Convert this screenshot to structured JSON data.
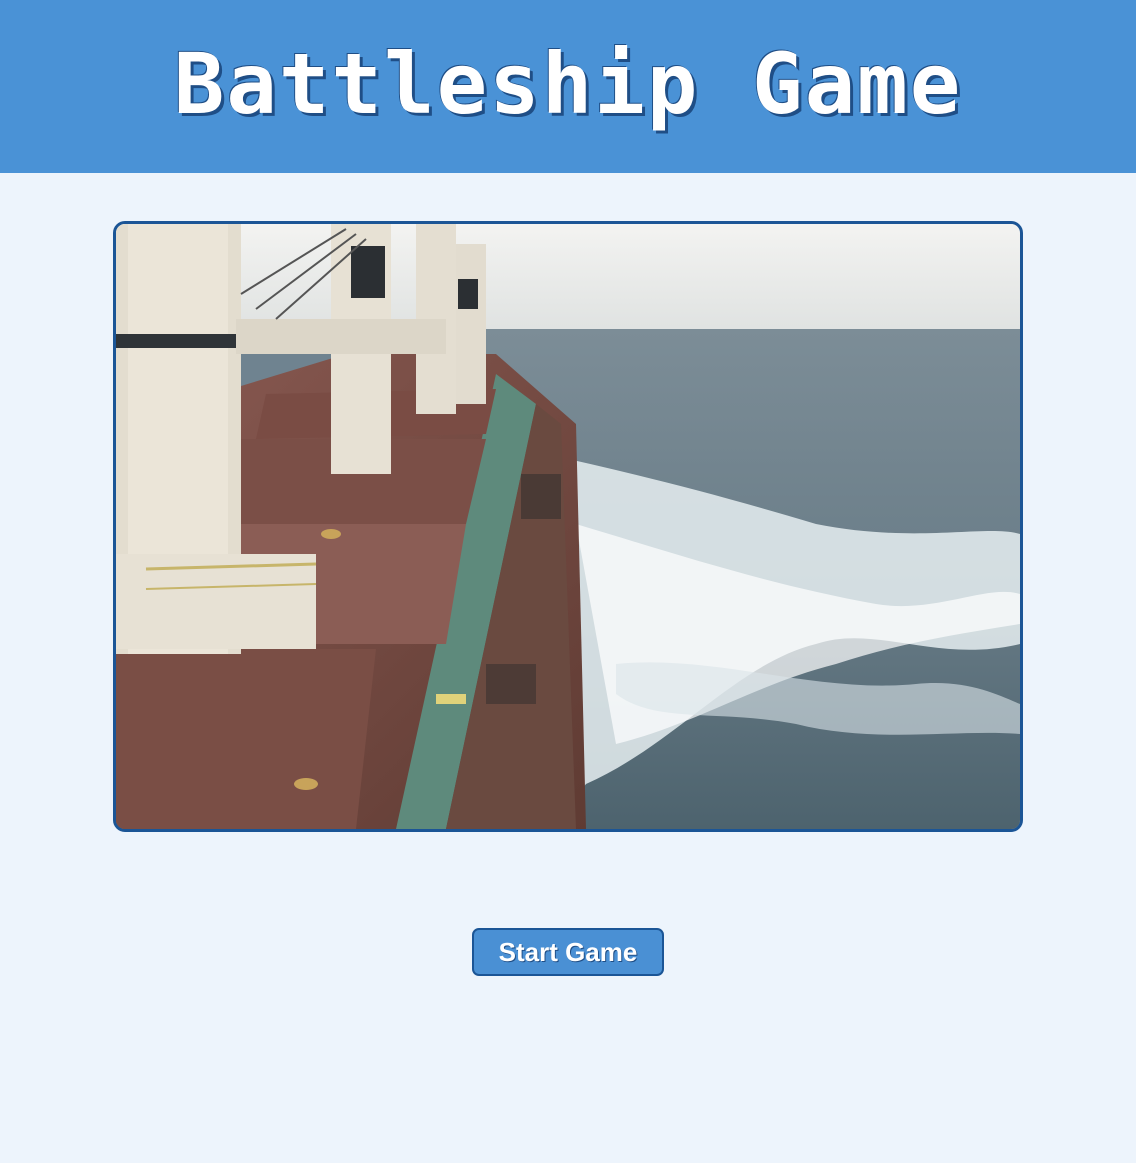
{
  "header": {
    "title": "Battleship Game",
    "background_color": "#4a92d6"
  },
  "hero_image": {
    "subject": "cargo-ship-at-sea",
    "border_color": "#1b5596"
  },
  "controls": {
    "start_label": "Start Game",
    "button_color": "#4a90d4"
  }
}
